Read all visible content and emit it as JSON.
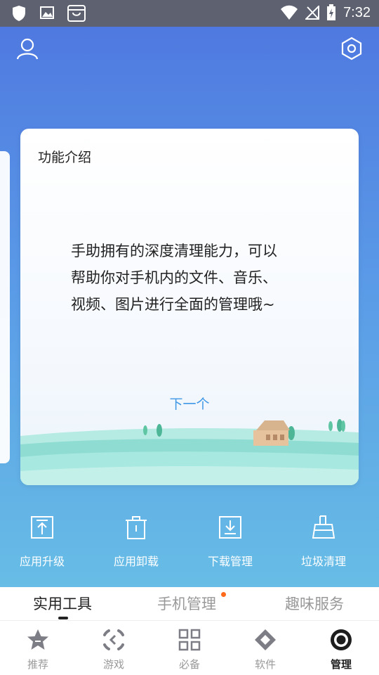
{
  "status_bar": {
    "time": "7:32",
    "icons": [
      "shield-icon",
      "image-icon",
      "bag-icon",
      "wifi-icon",
      "no-signal-icon",
      "battery-charging-icon"
    ]
  },
  "header": {
    "icons": [
      "user-icon",
      "settings-icon"
    ]
  },
  "card": {
    "title": "功能介绍",
    "body_lines": [
      "手助拥有的深度清理能力，可以",
      "帮助你对手机内的文件、音乐、",
      "视频、图片进行全面的管理哦~"
    ],
    "next_label": "下一个"
  },
  "tools": [
    {
      "label": "应用升级",
      "icon": "upgrade-icon"
    },
    {
      "label": "应用卸载",
      "icon": "trash-icon"
    },
    {
      "label": "下载管理",
      "icon": "download-icon"
    },
    {
      "label": "垃圾清理",
      "icon": "broom-icon"
    }
  ],
  "tabs": [
    {
      "label": "实用工具",
      "active": true
    },
    {
      "label": "手机管理",
      "active": false,
      "badge": true
    },
    {
      "label": "趣味服务",
      "active": false
    }
  ],
  "bottom_nav": [
    {
      "label": "推荐",
      "icon": "star-icon",
      "active": false
    },
    {
      "label": "游戏",
      "icon": "game-icon",
      "active": false
    },
    {
      "label": "必备",
      "icon": "grid-icon",
      "active": false
    },
    {
      "label": "软件",
      "icon": "diamond-icon",
      "active": false
    },
    {
      "label": "管理",
      "icon": "manage-icon",
      "active": true
    }
  ],
  "colors": {
    "accent": "#3f97e6",
    "hero_top": "#4f79e0",
    "hero_bottom": "#67bde6",
    "badge": "#ff6a1a"
  }
}
